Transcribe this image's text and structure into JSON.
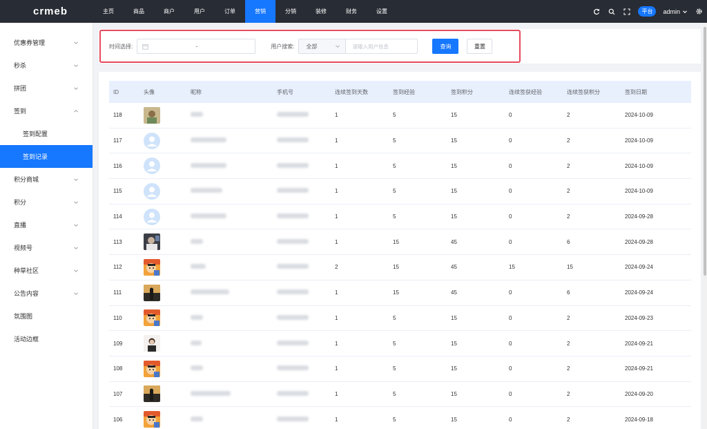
{
  "logo": "crmeb",
  "topnav": [
    "主页",
    "商品",
    "商户",
    "用户",
    "订单",
    "营销",
    "分销",
    "装修",
    "财务",
    "设置"
  ],
  "topnav_active": 5,
  "header": {
    "platform": "平台",
    "user": "admin"
  },
  "sidebar": [
    {
      "label": "优惠券管理",
      "type": "group"
    },
    {
      "label": "秒杀",
      "type": "group"
    },
    {
      "label": "拼团",
      "type": "group"
    },
    {
      "label": "签到",
      "type": "group",
      "open": true
    },
    {
      "label": "签到配置",
      "type": "sub"
    },
    {
      "label": "签到记录",
      "type": "sub",
      "active": true
    },
    {
      "label": "积分商城",
      "type": "group"
    },
    {
      "label": "积分",
      "type": "group"
    },
    {
      "label": "直播",
      "type": "group"
    },
    {
      "label": "视频号",
      "type": "group"
    },
    {
      "label": "种草社区",
      "type": "group"
    },
    {
      "label": "公告内容",
      "type": "group"
    },
    {
      "label": "氛围图",
      "type": "leaf"
    },
    {
      "label": "活动边框",
      "type": "leaf"
    }
  ],
  "filter": {
    "date_label": "时间选择:",
    "date_separator": "-",
    "user_label": "用户搜索:",
    "select_value": "全部",
    "search_placeholder": "请输入用户信息",
    "query_button": "查询",
    "reset_button": "重置"
  },
  "table": {
    "columns": [
      "ID",
      "头像",
      "昵称",
      "手机号",
      "连续签到天数",
      "签到经验",
      "签到积分",
      "连续签获经验",
      "连续签获积分",
      "签到日期"
    ],
    "rows": [
      {
        "id": "118",
        "avatar": "photo-a",
        "days": "1",
        "exp": "5",
        "int": "15",
        "cexp": "0",
        "cint": "2",
        "date": "2024-10-09"
      },
      {
        "id": "117",
        "avatar": "default",
        "days": "1",
        "exp": "5",
        "int": "15",
        "cexp": "0",
        "cint": "2",
        "date": "2024-10-09"
      },
      {
        "id": "116",
        "avatar": "default",
        "days": "1",
        "exp": "5",
        "int": "15",
        "cexp": "0",
        "cint": "2",
        "date": "2024-10-09"
      },
      {
        "id": "115",
        "avatar": "default",
        "days": "1",
        "exp": "5",
        "int": "15",
        "cexp": "0",
        "cint": "2",
        "date": "2024-10-09"
      },
      {
        "id": "114",
        "avatar": "default",
        "days": "1",
        "exp": "5",
        "int": "15",
        "cexp": "0",
        "cint": "2",
        "date": "2024-09-28"
      },
      {
        "id": "113",
        "avatar": "photo-b",
        "days": "1",
        "exp": "15",
        "int": "45",
        "cexp": "0",
        "cint": "6",
        "date": "2024-09-28"
      },
      {
        "id": "112",
        "avatar": "cartoon",
        "days": "2",
        "exp": "15",
        "int": "45",
        "cexp": "15",
        "cint": "15",
        "date": "2024-09-24"
      },
      {
        "id": "111",
        "avatar": "photo-c",
        "days": "1",
        "exp": "15",
        "int": "45",
        "cexp": "0",
        "cint": "6",
        "date": "2024-09-24"
      },
      {
        "id": "110",
        "avatar": "cartoon",
        "days": "1",
        "exp": "5",
        "int": "15",
        "cexp": "0",
        "cint": "2",
        "date": "2024-09-23"
      },
      {
        "id": "109",
        "avatar": "photo-d",
        "days": "1",
        "exp": "5",
        "int": "15",
        "cexp": "0",
        "cint": "2",
        "date": "2024-09-21"
      },
      {
        "id": "108",
        "avatar": "cartoon",
        "days": "1",
        "exp": "5",
        "int": "15",
        "cexp": "0",
        "cint": "2",
        "date": "2024-09-21"
      },
      {
        "id": "107",
        "avatar": "photo-c",
        "days": "1",
        "exp": "5",
        "int": "15",
        "cexp": "0",
        "cint": "2",
        "date": "2024-09-20"
      },
      {
        "id": "106",
        "avatar": "cartoon",
        "days": "1",
        "exp": "5",
        "int": "15",
        "cexp": "0",
        "cint": "2",
        "date": "2024-09-18"
      }
    ]
  },
  "colors": {
    "primary": "#1677ff",
    "topbar": "#282c34",
    "highlight": "#e5495c"
  }
}
